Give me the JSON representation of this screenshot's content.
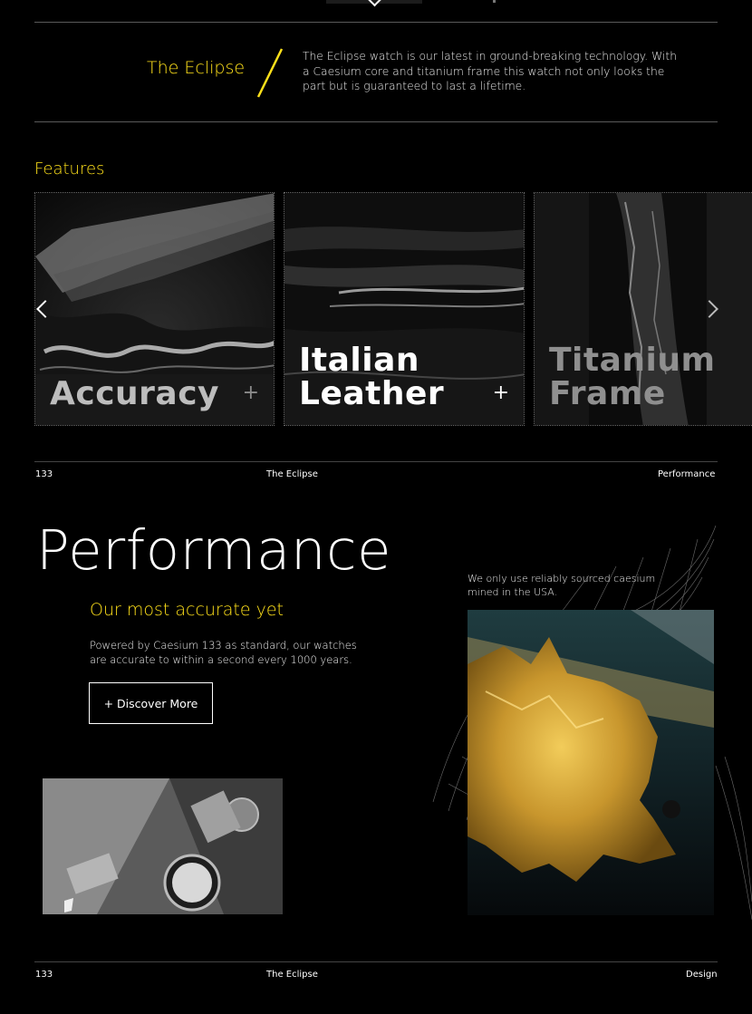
{
  "intro": {
    "title": "The Eclipse",
    "description": "The Eclipse watch is our latest in ground-breaking technology. With a Caesium core and titanium frame this watch not only looks the part but is guaranteed to last a lifetime."
  },
  "features": {
    "heading": "Features",
    "cards": [
      {
        "title_line1": "",
        "title_line2": "Accuracy",
        "plus": "+"
      },
      {
        "title_line1": "Italian",
        "title_line2": "Leather",
        "plus": "+"
      },
      {
        "title_line1": "Titanium",
        "title_line2": "Frame",
        "plus": ""
      }
    ]
  },
  "footer1": {
    "page": "133",
    "title": "The Eclipse",
    "section": "Performance"
  },
  "performance": {
    "title": "Performance",
    "subtitle": "Our most accurate yet",
    "text": "Powered by Caesium 133 as standard, our watches are accurate to within a second every 1000 years.",
    "button_label": "+ Discover More",
    "caesium_note": "We only use reliably sourced caesium mined in the USA."
  },
  "footer2": {
    "page": "133",
    "title": "The Eclipse",
    "section": "Design"
  },
  "colors": {
    "accent": "#ffe11a",
    "background": "#000000"
  }
}
